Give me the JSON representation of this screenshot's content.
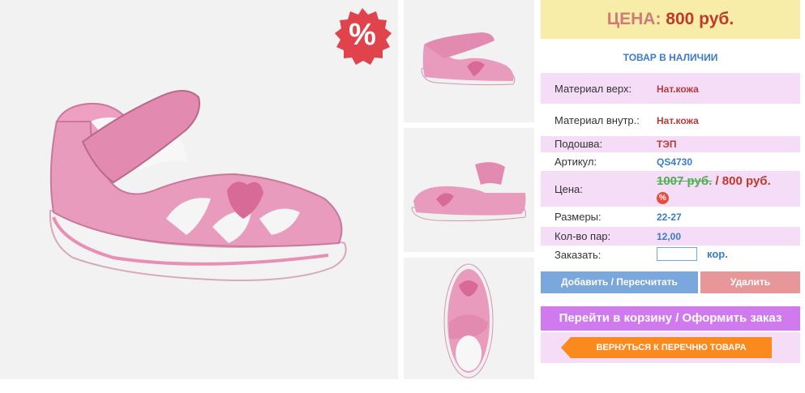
{
  "discount_badge": {
    "symbol": "%"
  },
  "price_box": {
    "label": "ЦЕНА:",
    "value": "800 руб."
  },
  "stock_status": "ТОВАР В НАЛИЧИИ",
  "specs": [
    {
      "label": "Материал верх:",
      "value": "Нат.кожа"
    },
    {
      "label": "Материал внутр.:",
      "value": "Нат.кожа"
    },
    {
      "label": "Подошва:",
      "value": "ТЭП"
    },
    {
      "label": "Артикул:",
      "value": "QS4730"
    },
    {
      "label": "Цена:",
      "old_price": "1007 руб.",
      "separator": " / ",
      "new_price": "800 руб.",
      "badge": "%"
    },
    {
      "label": "Размеры:",
      "value": "22-27"
    },
    {
      "label": "Кол-во пар:",
      "value": "12,00"
    },
    {
      "label": "Заказать:",
      "input_value": "",
      "unit": "кор."
    }
  ],
  "buttons": {
    "add": "Добавить / Пересчитать",
    "delete": "Удалить",
    "cart": "Перейти в корзину / Оформить заказ",
    "back": "ВЕРНУТЬСЯ К ПЕРЕЧНЮ ТОВАРА"
  },
  "colors": {
    "price_bg": "#f8eda8",
    "row_pink": "#f5dcf7",
    "accent_blue": "#3b7bc9",
    "price_red": "#c0392b",
    "cart_purple": "#d179ee",
    "back_orange": "#fb8a1e"
  }
}
